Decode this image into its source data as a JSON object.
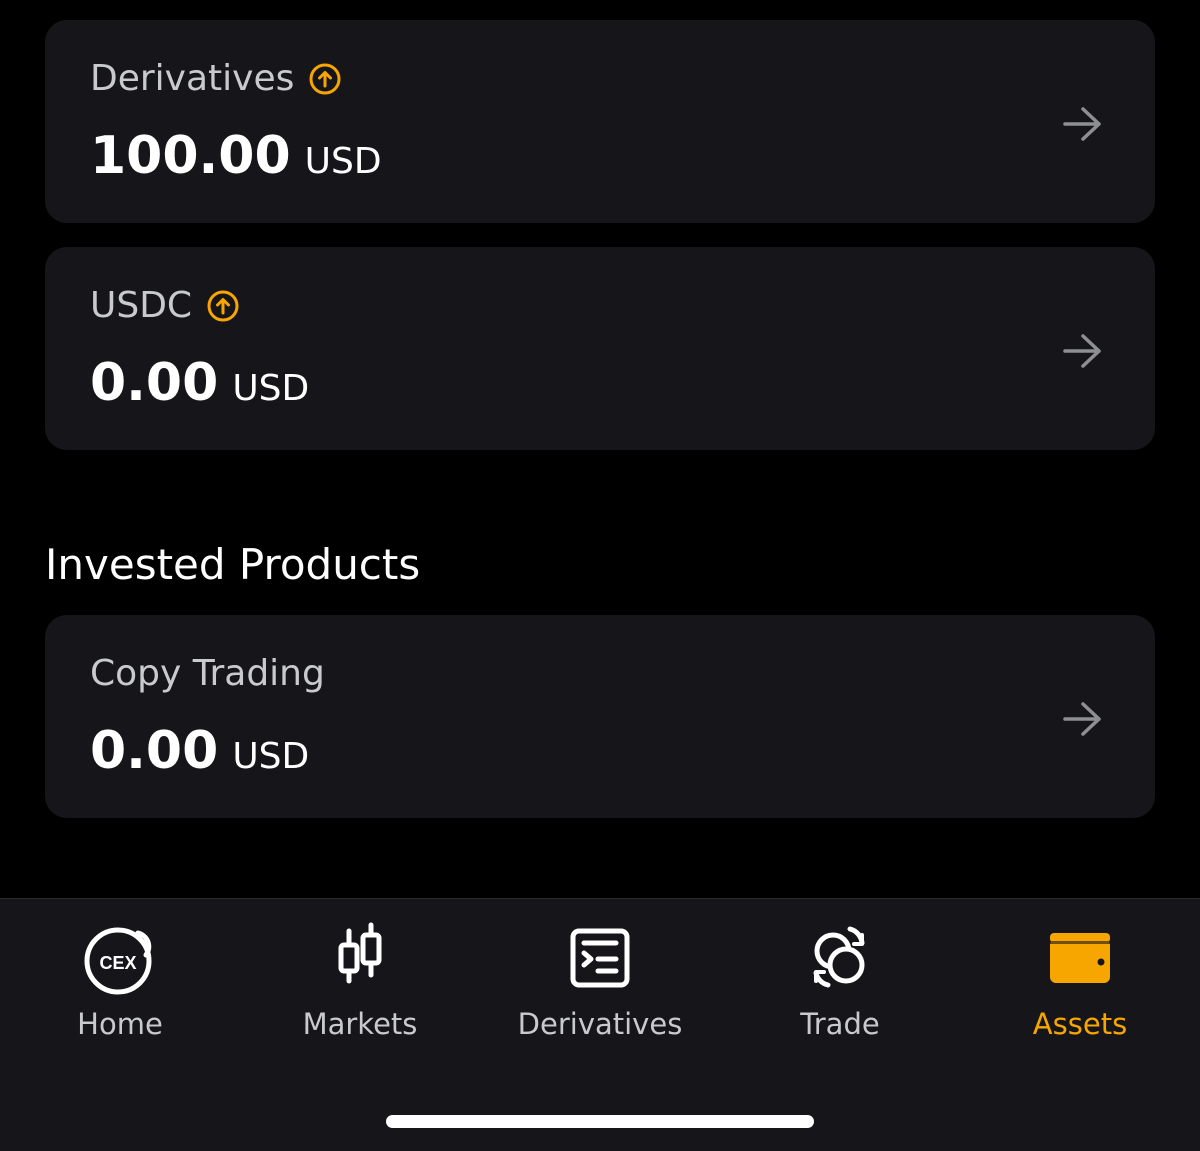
{
  "accounts": [
    {
      "label": "Derivatives",
      "amount": "100.00",
      "unit": "USD",
      "icon": "arrow-up-circle-icon"
    },
    {
      "label": "USDC",
      "amount": "0.00",
      "unit": "USD",
      "icon": "arrow-up-circle-icon"
    }
  ],
  "invested": {
    "title": "Invested Products",
    "items": [
      {
        "label": "Copy Trading",
        "amount": "0.00",
        "unit": "USD"
      }
    ]
  },
  "tabbar": {
    "active": "Assets",
    "active_color": "#f7a600",
    "items": [
      {
        "label": "Home",
        "icon": "cex-icon",
        "badge": "CEX"
      },
      {
        "label": "Markets",
        "icon": "candlestick-icon"
      },
      {
        "label": "Derivatives",
        "icon": "derivatives-doc-icon"
      },
      {
        "label": "Trade",
        "icon": "trade-swap-icon"
      },
      {
        "label": "Assets",
        "icon": "wallet-icon"
      }
    ]
  }
}
